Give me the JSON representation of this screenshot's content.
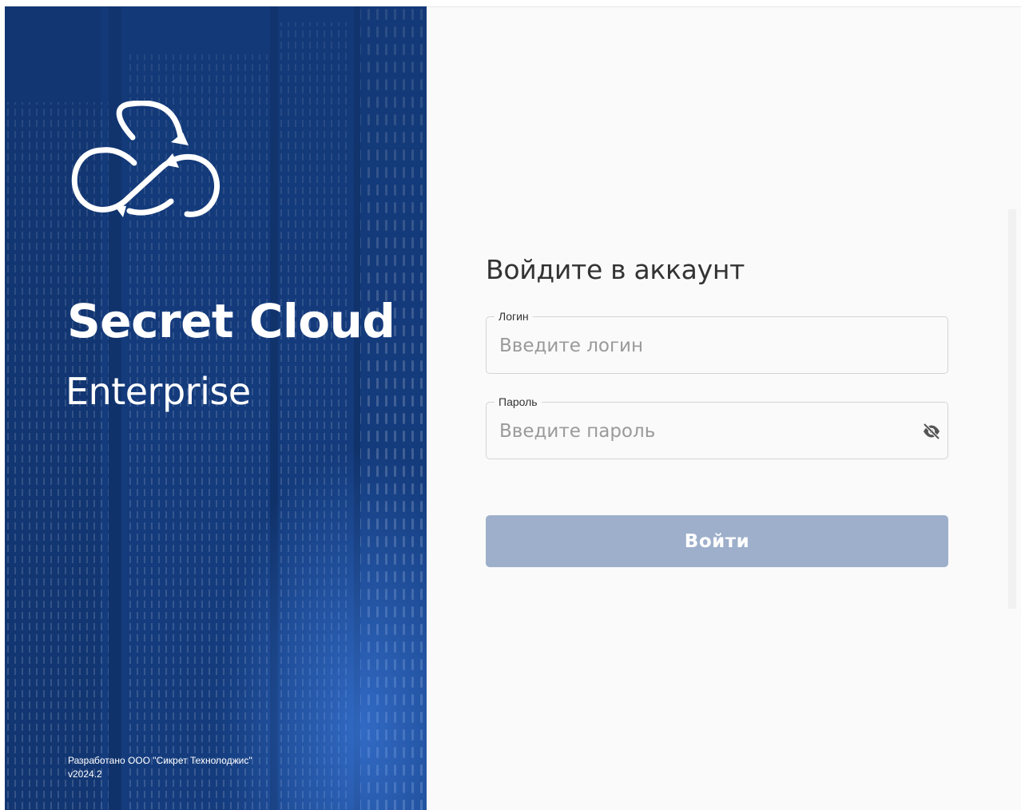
{
  "colors": {
    "hero_bg": "#143c7e",
    "button_disabled": "#9dafca",
    "text_primary": "#333333",
    "placeholder": "#9a9a9a",
    "field_border": "#d5d5d5"
  },
  "hero": {
    "logo_icon": "cloud-infinity-icon",
    "brand_title": "Secret Cloud",
    "brand_subtitle": "Enterprise",
    "developer_text": "Разработано ООО \"Сикрет Технолоджис\"",
    "version": "v2024.2"
  },
  "login_form": {
    "title": "Войдите в аккаунт",
    "login": {
      "label": "Логин",
      "placeholder": "Введите логин",
      "value": ""
    },
    "password": {
      "label": "Пароль",
      "placeholder": "Введите пароль",
      "value": "",
      "visibility_icon": "eye-off-icon"
    },
    "submit_label": "Войти"
  }
}
